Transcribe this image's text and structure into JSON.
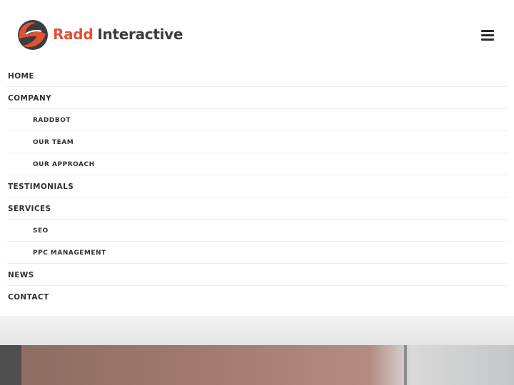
{
  "brand": {
    "name_part1": "Radd",
    "name_part2": "Interactive",
    "logo_icon": "radd-logo-icon",
    "accent_color": "#e5512f",
    "dark_color": "#3a3d40"
  },
  "header": {
    "menu_icon": "hamburger-menu-icon"
  },
  "menu": {
    "items": [
      {
        "label": "HOME",
        "level": 0
      },
      {
        "label": "COMPANY",
        "level": 0
      },
      {
        "label": "RADDBOT",
        "level": 1
      },
      {
        "label": "OUR TEAM",
        "level": 1
      },
      {
        "label": "OUR APPROACH",
        "level": 1
      },
      {
        "label": "TESTIMONIALS",
        "level": 0
      },
      {
        "label": "SERVICES",
        "level": 0
      },
      {
        "label": "SEO",
        "level": 1
      },
      {
        "label": "PPC MANAGEMENT",
        "level": 1
      },
      {
        "label": "NEWS",
        "level": 0
      },
      {
        "label": "CONTACT",
        "level": 0
      }
    ]
  }
}
